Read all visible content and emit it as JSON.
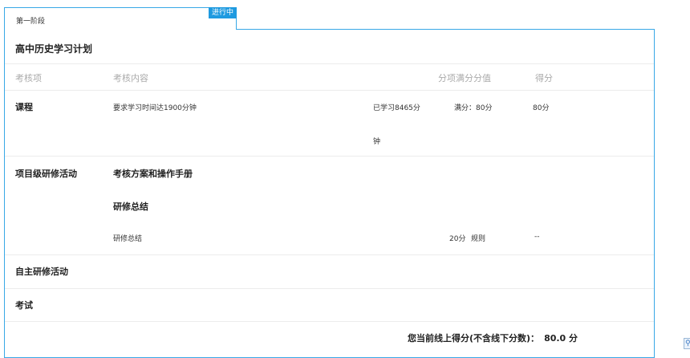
{
  "stage_tab": {
    "label": "第一阶段",
    "badge": "进行中"
  },
  "plan_title": "高中历史学习计划",
  "headers": {
    "item": "考核项",
    "content": "考核内容",
    "full_score": "分项满分分值",
    "score": "得分"
  },
  "course": {
    "name": "课程",
    "requirement": "要求学习时间达1900分钟",
    "progress_line1": "已学习8465分",
    "progress_line2": "钟",
    "full_score": "满分：80分",
    "score": "80分"
  },
  "project": {
    "name": "项目级研修活动",
    "sub1": "考核方案和操作手册",
    "sub2": "研修总结",
    "detail_name": "研修总结",
    "detail_score": "20分",
    "detail_rule": "规则",
    "detail_result": "--"
  },
  "self_study": {
    "name": "自主研修活动"
  },
  "exam": {
    "name": "考试"
  },
  "total": {
    "label": "您当前线上得分(不含线下分数)：",
    "value": "80.0 分"
  },
  "corner_icon": "page-corner-icon"
}
